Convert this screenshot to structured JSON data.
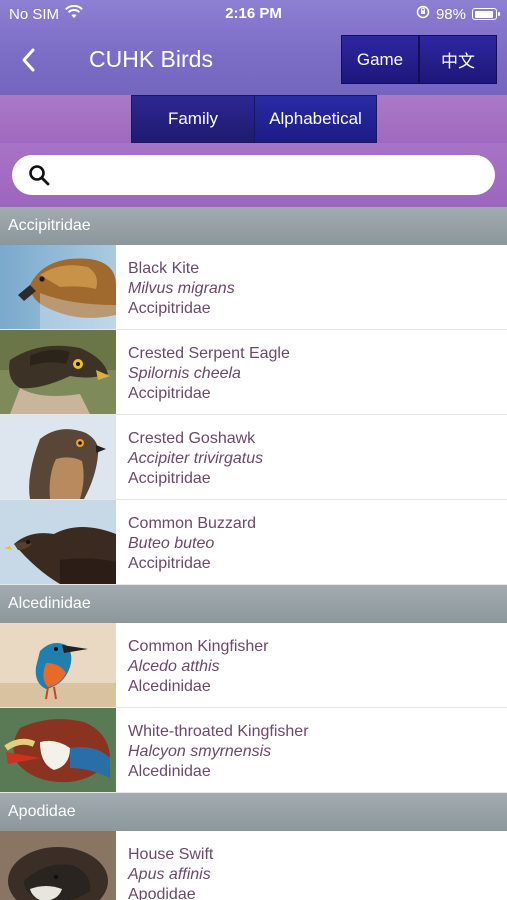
{
  "status": {
    "carrier": "No SIM",
    "time": "2:16 PM",
    "battery": "98%",
    "battery_level": 0.98
  },
  "nav": {
    "title": "CUHK Birds",
    "game_label": "Game",
    "lang_label": "中文"
  },
  "segments": {
    "family": "Family",
    "alphabetical": "Alphabetical",
    "active": "alphabetical"
  },
  "search": {
    "placeholder": "",
    "value": ""
  },
  "sections": [
    {
      "title": "Accipitridae",
      "items": [
        {
          "name": "Black Kite",
          "scientific": "Milvus migrans",
          "family": "Accipitridae"
        },
        {
          "name": "Crested Serpent Eagle",
          "scientific": "Spilornis cheela",
          "family": "Accipitridae"
        },
        {
          "name": "Crested Goshawk",
          "scientific": "Accipiter trivirgatus",
          "family": "Accipitridae"
        },
        {
          "name": "Common Buzzard",
          "scientific": "Buteo buteo",
          "family": "Accipitridae"
        }
      ]
    },
    {
      "title": "Alcedinidae",
      "items": [
        {
          "name": "Common Kingfisher",
          "scientific": "Alcedo atthis",
          "family": "Alcedinidae"
        },
        {
          "name": "White-throated Kingfisher",
          "scientific": "Halcyon smyrnensis",
          "family": "Alcedinidae"
        }
      ]
    },
    {
      "title": "Apodidae",
      "items": [
        {
          "name": "House Swift",
          "scientific": "Apus affinis",
          "family": "Apodidae"
        }
      ]
    }
  ]
}
